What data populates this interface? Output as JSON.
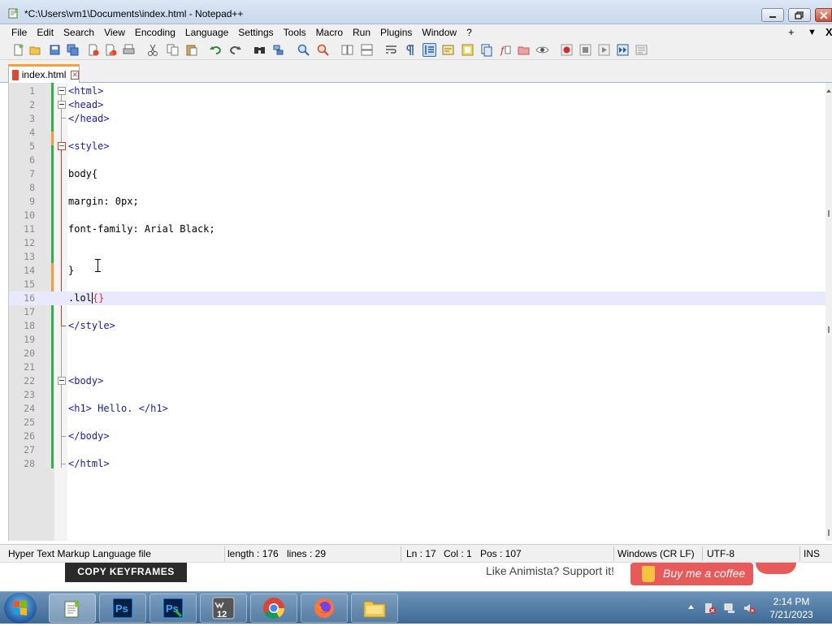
{
  "window": {
    "title": "*C:\\Users\\vm1\\Documents\\index.html - Notepad++"
  },
  "menu": {
    "items": [
      "File",
      "Edit",
      "Search",
      "View",
      "Encoding",
      "Language",
      "Settings",
      "Tools",
      "Macro",
      "Run",
      "Plugins",
      "Window",
      "?"
    ],
    "right": [
      "+",
      "▼",
      "X"
    ]
  },
  "tab": {
    "label": "index.html"
  },
  "editor": {
    "lines": [
      {
        "n": "1",
        "text": "<html>"
      },
      {
        "n": "2",
        "text": "<head>"
      },
      {
        "n": "3",
        "text": "</head>"
      },
      {
        "n": "4",
        "text": ""
      },
      {
        "n": "5",
        "text": "<style>"
      },
      {
        "n": "6",
        "text": ""
      },
      {
        "n": "7",
        "text": "body{"
      },
      {
        "n": "8",
        "text": ""
      },
      {
        "n": "9",
        "text": "margin: 0px;"
      },
      {
        "n": "10",
        "text": ""
      },
      {
        "n": "11",
        "text": "font-family: Arial Black;"
      },
      {
        "n": "12",
        "text": ""
      },
      {
        "n": "13",
        "text": ""
      },
      {
        "n": "14",
        "text": "}"
      },
      {
        "n": "15",
        "text": ""
      },
      {
        "n": "16",
        "text": ".lol{}"
      },
      {
        "n": "17",
        "text": ""
      },
      {
        "n": "18",
        "text": "</style>"
      },
      {
        "n": "19",
        "text": ""
      },
      {
        "n": "20",
        "text": ""
      },
      {
        "n": "21",
        "text": ""
      },
      {
        "n": "22",
        "text": "<body>"
      },
      {
        "n": "23",
        "text": ""
      },
      {
        "n": "24",
        "text": "<h1> Hello. </h1>"
      },
      {
        "n": "25",
        "text": ""
      },
      {
        "n": "26",
        "text": "</body>"
      },
      {
        "n": "27",
        "text": ""
      },
      {
        "n": "28",
        "text": "</html>"
      }
    ]
  },
  "status": {
    "file_type": "Hyper Text Markup Language file",
    "length": "length : 176",
    "lines": "lines : 29",
    "ln": "Ln : 17",
    "col": "Col : 1",
    "pos": "Pos : 107",
    "eol": "Windows (CR LF)",
    "encoding": "UTF-8",
    "mode": "INS"
  },
  "webpage": {
    "button": "COPY KEYFRAMES",
    "support_text": "Like Animista? Support it!",
    "coffee": "Buy me a coffee"
  },
  "taskbar": {
    "time": "2:14 PM",
    "date": "7/21/2023",
    "apps": [
      "notepad-plus-plus",
      "photoshop",
      "photoshop-2",
      "workbench-12",
      "chrome",
      "firefox",
      "file-explorer"
    ],
    "ps_label": "Ps",
    "wb_label": "12"
  },
  "colors": {
    "tag": "#1a1ab0",
    "current_line": "#e8e8ff",
    "fold_red": "#d23c2c",
    "change_green": "#2db34a",
    "change_orange": "#f39c3c"
  }
}
